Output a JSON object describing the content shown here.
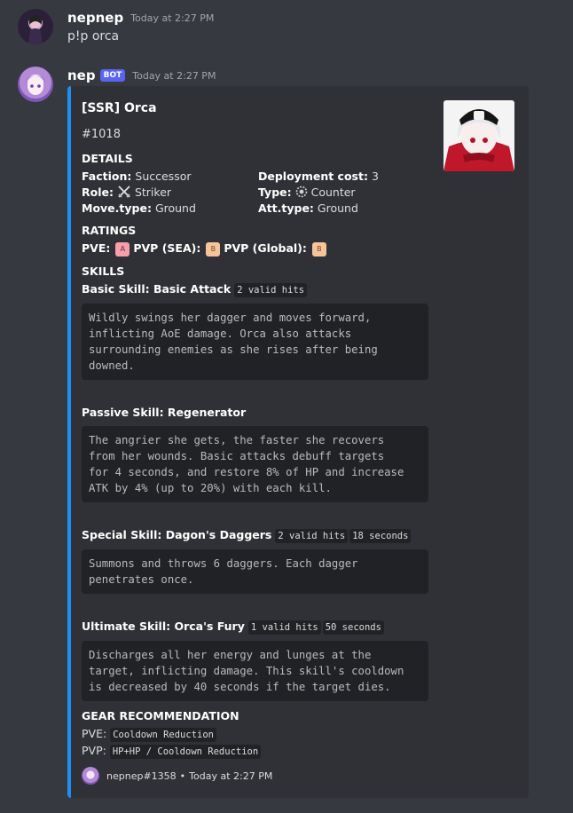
{
  "message1": {
    "username": "nepnep",
    "timestamp": "Today at 2:27 PM",
    "text": "p!p orca"
  },
  "message2": {
    "username": "nep",
    "bot_badge": "BOT",
    "timestamp": "Today at 2:27 PM"
  },
  "embed": {
    "accent_color": "#1d8ff2",
    "title": "[SSR] Orca",
    "id": "#1018",
    "details_heading": "DETAILS",
    "details": {
      "faction_label": "Faction:",
      "faction_value": "Successor",
      "deployment_label": "Deployment cost:",
      "deployment_value": "3",
      "role_label": "Role:",
      "role_value": "Striker",
      "type_label": "Type:",
      "type_value": "Counter",
      "movetype_label": "Move.type:",
      "movetype_value": "Ground",
      "atttype_label": "Att.type:",
      "atttype_value": "Ground"
    },
    "ratings_heading": "RATINGS",
    "ratings": {
      "pve_label": "PVE:",
      "pve_tag": "A",
      "pvp_sea_label": "PVP (SEA):",
      "pvp_sea_tag": "B",
      "pvp_global_label": "PVP (Global):",
      "pvp_global_tag": "B"
    },
    "skills_heading": "SKILLS",
    "skills": [
      {
        "name": "Basic Skill: Basic Attack",
        "tags": [
          "2 valid hits"
        ],
        "description": "Wildly swings her dagger and moves forward,\ninflicting AoE damage. Orca also attacks\nsurrounding enemies as she rises after being\ndowned."
      },
      {
        "name": "Passive Skill: Regenerator",
        "tags": [],
        "description": "The angrier she gets, the faster she recovers\nfrom her wounds. Basic attacks debuff targets\nfor 4 seconds, and restore 8% of HP and increase\nATK by 4% (up to 20%) with each kill."
      },
      {
        "name": "Special Skill: Dagon's Daggers",
        "tags": [
          "2 valid hits",
          "18 seconds"
        ],
        "description": "Summons and throws 6 daggers. Each dagger\npenetrates once."
      },
      {
        "name": "Ultimate Skill: Orca's Fury",
        "tags": [
          "1 valid hits",
          "50 seconds"
        ],
        "description": "Discharges all her energy and lunges at the\ntarget, inflicting damage. This skill's cooldown\nis decreased by 40 seconds if the target dies."
      }
    ],
    "gear_heading": "GEAR RECOMMENDATION",
    "gear": {
      "pve_label": "PVE:",
      "pve_value": "Cooldown Reduction",
      "pvp_label": "PVP:",
      "pvp_value": "HP+HP / Cooldown Reduction"
    },
    "footer": {
      "author": "nepnep#1358",
      "separator": "•",
      "timestamp": "Today at 2:27 PM"
    }
  }
}
